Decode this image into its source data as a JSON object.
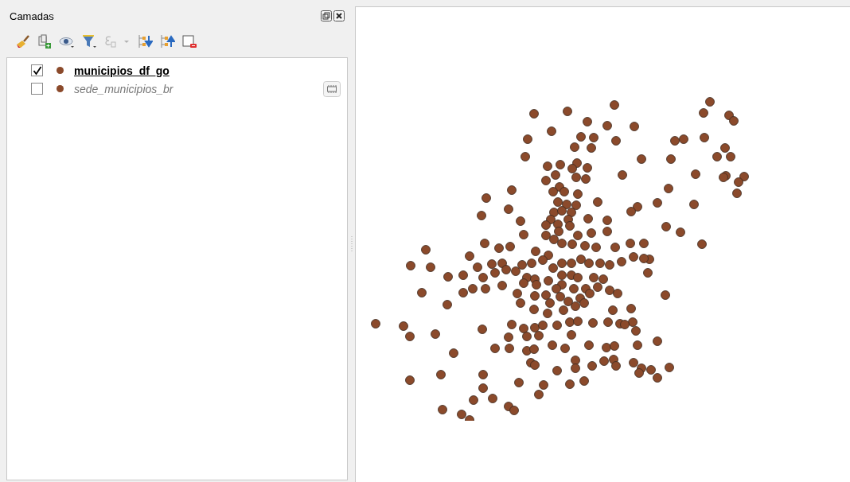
{
  "panel": {
    "title": "Camadas"
  },
  "toolbar": [
    {
      "kind": "style",
      "disabled": false
    },
    {
      "kind": "add-group",
      "disabled": false
    },
    {
      "kind": "visibility",
      "disabled": false
    },
    {
      "kind": "filter",
      "disabled": false
    },
    {
      "kind": "expression",
      "disabled": true
    },
    {
      "kind": "expand",
      "disabled": false
    },
    {
      "kind": "collapse",
      "disabled": false
    },
    {
      "kind": "remove",
      "disabled": false
    }
  ],
  "layers": [
    {
      "name": "municipios_df_go",
      "checked": true,
      "selected": true,
      "temporary": false
    },
    {
      "name": "sede_municipios_br",
      "checked": false,
      "selected": false,
      "temporary": true
    }
  ]
}
